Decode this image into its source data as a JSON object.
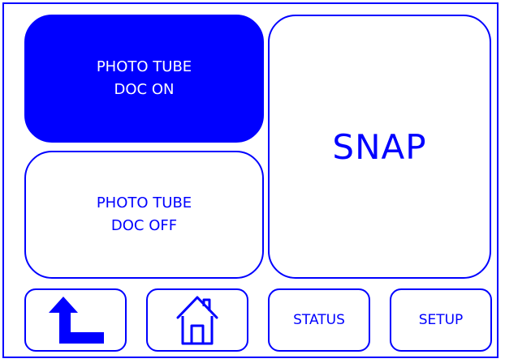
{
  "panel": {
    "photo_tube_doc_on": {
      "line1": "PHOTO TUBE",
      "line2": "DOC ON",
      "state": "active",
      "active_color": "#0000ff"
    },
    "photo_tube_doc_off": {
      "line1": "PHOTO TUBE",
      "line2": "DOC OFF",
      "state": "inactive"
    },
    "snap": {
      "label": "SNAP"
    }
  },
  "toolbar": {
    "back": {
      "icon": "back-arrow-icon"
    },
    "home": {
      "icon": "home-icon"
    },
    "status": {
      "label": "STATUS"
    },
    "setup": {
      "label": "SETUP"
    }
  },
  "colors": {
    "accent": "#0000ff",
    "background": "#ffffff",
    "active_text": "#ffffff"
  }
}
